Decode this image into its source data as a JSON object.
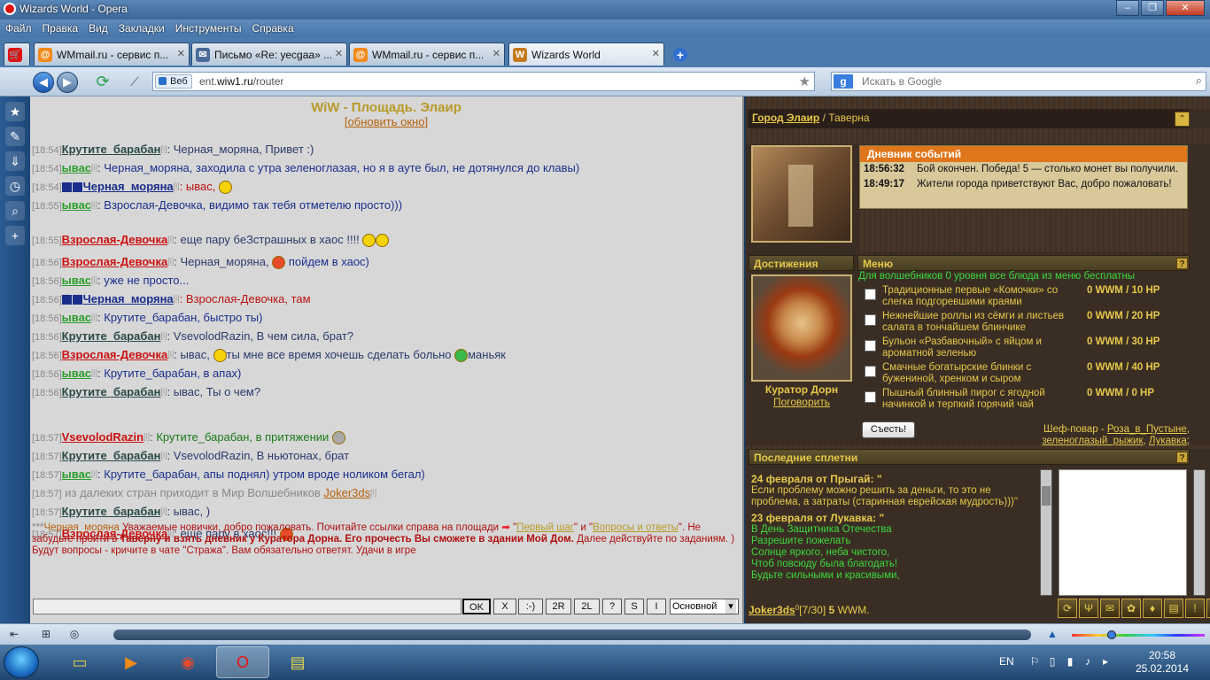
{
  "window": {
    "title": "Wizards World - Opera"
  },
  "menubar": {
    "items": [
      "Файл",
      "Правка",
      "Вид",
      "Закладки",
      "Инструменты",
      "Справка"
    ]
  },
  "tabs": [
    {
      "label": "WMmail.ru - сервис п...",
      "icon": "wmmail-icon"
    },
    {
      "label": "Письмо «Re: уесgaa» ...",
      "icon": "mail-icon"
    },
    {
      "label": "WMmail.ru - сервис п...",
      "icon": "wmmail-icon"
    },
    {
      "label": "Wizards World",
      "icon": "wiw-icon",
      "active": true
    }
  ],
  "address": {
    "badge": "Веб",
    "host_prefix": "ent.",
    "host": "wiw1.ru",
    "path": "/router"
  },
  "search": {
    "placeholder": "Искать в Google"
  },
  "chat": {
    "title": "WiW - Площадь. Элаир",
    "refresh_label": "обновить окно",
    "messages": [
      {
        "ts": "[18:54]",
        "nick": "Крутите_барабан",
        "inf": "[i]",
        "text": ": Черная_моряна, Привет :)"
      },
      {
        "ts": "[18:54]",
        "nick": "ывас",
        "inf": "[i]",
        "text": ": Черная_моряна, заходила с утра зеленоглазая, но я в ауте был, не дотянулся до клавы)"
      },
      {
        "ts": "[18:54]",
        "nick": "Черная_моряна",
        "inf": "[i]",
        "text": ": ывас,"
      },
      {
        "ts": "[18:55]",
        "nick": "ывас",
        "inf": "[i]",
        "text": ": Взрослая-Девочка, видимо так тебя отметелю просто)))"
      },
      {
        "ts": "[18:55]",
        "nick": "Взрослая-Девочка",
        "inf": "[i]",
        "text": ": еще пару беЗстрашных в хаос !!!!"
      },
      {
        "ts": "[18:56]",
        "nick": "Взрослая-Девочка",
        "inf": "[i]",
        "text": ": Черная_моряна,",
        "text2": " пойдем в хаос)"
      },
      {
        "ts": "[18:56]",
        "nick": "ывас",
        "inf": "[i]",
        "text": ": уже не просто..."
      },
      {
        "ts": "[18:56]",
        "nick": "Черная_моряна",
        "inf": "[i]",
        "text": ": Взрослая-Девочка, там"
      },
      {
        "ts": "[18:56]",
        "nick": "ывас",
        "inf": "[i]",
        "text": ": Крутите_барабан, быстро ты)"
      },
      {
        "ts": "[18:56]",
        "nick": "Крутите_барабан",
        "inf": "[i]",
        "text": ": VsevolodRazin, В чем сила, брат?"
      },
      {
        "ts": "[18:56]",
        "nick": "Взрослая-Девочка",
        "inf": "[i]",
        "text": ": ывас,",
        "text2": "ты мне все время хочешь сделать больно",
        "text3": "маньяк"
      },
      {
        "ts": "[18:56]",
        "nick": "ывас",
        "inf": "[i]",
        "text": ": Крутите_барабан, в апах)"
      },
      {
        "ts": "[18:56]",
        "nick": "Крутите_барабан",
        "inf": "[i]",
        "text": ": ывас, Ты о чем?"
      },
      {
        "ts": "[18:57]",
        "nick": "VsevolodRazin",
        "inf": "[i]",
        "text": ": Крутите_барабан, в притяжении"
      },
      {
        "ts": "[18:57]",
        "nick": "Крутите_барабан",
        "inf": "[i]",
        "text": ": VsevolodRazin, В ньютонах, брат"
      },
      {
        "ts": "[18:57]",
        "nick": "ывас",
        "inf": "[i]",
        "text": ": Крутите_барабан, апы поднял) утром вроде ноликом бегал)"
      },
      {
        "ts": "[18:57]",
        "text": "из далеких стран приходит в Мир Волшебников ",
        "link": "Joker3ds",
        "inf": "[i]"
      },
      {
        "ts": "[18:57]",
        "nick": "Крутите_барабан",
        "inf": "[i]",
        "text": ": ывас, )"
      },
      {
        "ts": "[18:57]",
        "nick": "Взрослая-Девочка",
        "inf": "[i]",
        "text": ": еще пару в хаос!!!"
      }
    ],
    "welcome": {
      "prefix": "***",
      "nick": "Черная_моряна",
      "part1": " Уважаемые новички, добро пожаловать. Почитайте ссылки справа на площади ",
      "link1": "Первый шаг",
      "mid": " и \"",
      "link2": "Вопросы и ответы",
      "part2": "\". Не забудьте пройти в ",
      "bold": "Таверну и взять дневник у Куратора Дорна. Его прочесть Вы сможете в здании Мой Дом.",
      "part3": " Далее действуйте по заданиям. ) Будут вопросы - кричите в чате \"Стража\". Вам обязательно ответят. Удачи в игре"
    },
    "buttons": [
      "OK",
      "X",
      ":-)",
      "2R",
      "2L",
      "?",
      "S",
      "I"
    ],
    "channel": "Основной"
  },
  "game": {
    "location": {
      "city": "Город Элаир",
      "sep": " / ",
      "place": "Таверна"
    },
    "diary": {
      "title": "Дневник событий",
      "entries": [
        {
          "time": "18:56:32",
          "text": "Бой окончен. Победа! 5 — столько монет вы получили."
        },
        {
          "time": "18:49:17",
          "text": "Жители города приветствуют Вас, добро пожаловать!"
        }
      ]
    },
    "achievements_title": "Достижения",
    "menu_title": "Меню",
    "menu_free": "Для волшебников 0 уровня все блюда из меню бесплатны",
    "menu_items": [
      {
        "name": "Традиционные первые «Комочки» со слегка подгоревшими краями",
        "price": "0 WWM / 10 HP"
      },
      {
        "name": "Нежнейшие роллы из сёмги и листьев салата в тончайшем блинчике",
        "price": "0 WWM / 20 HP"
      },
      {
        "name": "Бульон «Разбавочный» с яйцом и ароматной зеленью",
        "price": "0 WWM / 30 HP"
      },
      {
        "name": "Смачные богатырские блинки с бужениной, хренком и сыром",
        "price": "0 WWM / 40 HP"
      },
      {
        "name": "Пышный блинный пирог с ягодной начинкой и терпкий горячий чай",
        "price": "0 WWM / 0 HP"
      }
    ],
    "eat_button": "Съесть!",
    "curator": {
      "name": "Куратор Дорн",
      "talk": "Поговорить"
    },
    "chef": {
      "label": "Шеф-повар - ",
      "names": [
        "Роза_в_Пустыне",
        "зеленоглазый_рыжик",
        "Лукавка"
      ]
    },
    "gossip_title": "Последние сплетни",
    "gossip": [
      {
        "head": "24 февраля от Прыгай:  \"",
        "body": "Если проблему можно решить за деньги, то это не проблема, а затраты (старинная еврейская мудрость)))\"",
        "color": "y"
      },
      {
        "head": "23 февраля от Лукавка:  \"",
        "body": "В День Защитника Отечества\nРазрешите пожелать\nСолнце яркого, неба чистого,\nЧтоб повсюду была благодать!\nБудьте сильными и красивыми,",
        "color": "g"
      }
    ],
    "player": {
      "nick": "Joker3ds",
      "level": "0",
      "hp": "[7/30]",
      "money": "5",
      "currency": "WWM."
    }
  },
  "taskbar": {
    "lang": "EN",
    "time": "20:58",
    "date": "25.02.2014"
  }
}
